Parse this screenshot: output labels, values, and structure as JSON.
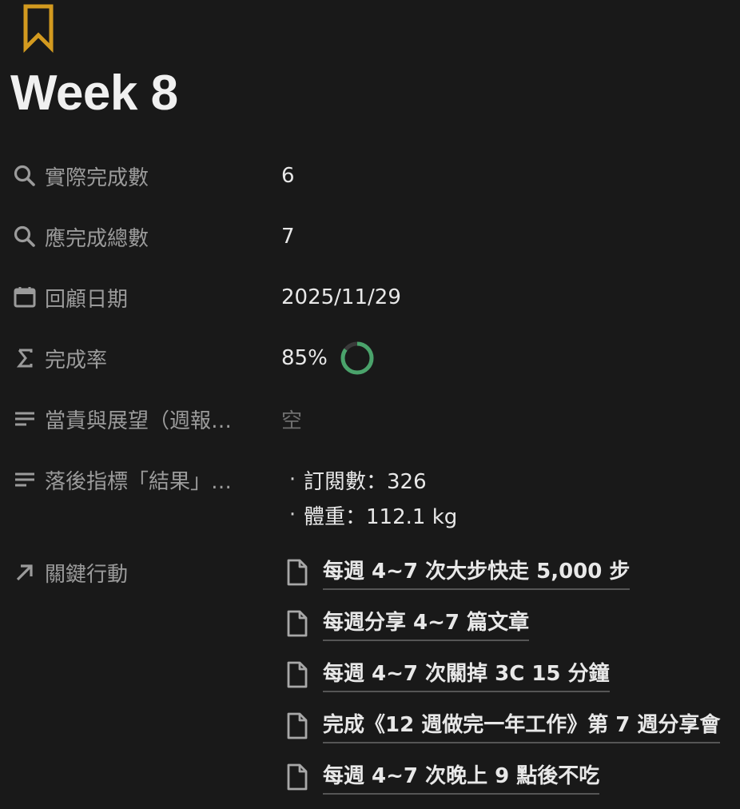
{
  "page": {
    "icon": "bookmark-icon",
    "icon_color": "#d39a1f",
    "title": "Week 8"
  },
  "properties": [
    {
      "key": "actual_done",
      "icon": "search-icon",
      "label": "實際完成數",
      "value": "6"
    },
    {
      "key": "should_done",
      "icon": "search-icon",
      "label": "應完成總數",
      "value": "7"
    },
    {
      "key": "review_date",
      "icon": "calendar-icon",
      "label": "回顧日期",
      "value": "2025/11/29"
    },
    {
      "key": "completion_rate",
      "icon": "sigma-icon",
      "label": "完成率",
      "value": "85%",
      "progress": 0.85,
      "progress_color": "#4aa36b"
    },
    {
      "key": "reflection",
      "icon": "text-lines-icon",
      "label": "當責與展望（週報…",
      "value": "空"
    },
    {
      "key": "lagging",
      "icon": "text-lines-icon",
      "label": "落後指標「結果」…",
      "bullets": [
        "訂閱數：326",
        "體重：112.1 kg"
      ]
    },
    {
      "key": "key_actions",
      "icon": "arrow-up-right-icon",
      "label": "關鍵行動",
      "relations": [
        "每週 4~7 次大步快走 5,000 步",
        "每週分享 4~7 篇文章",
        "每週 4~7 次關掉 3C 15 分鐘",
        "完成《12 週做完一年工作》第 7 週分享會",
        "每週 4~7 次晚上 9 點後不吃"
      ]
    }
  ]
}
